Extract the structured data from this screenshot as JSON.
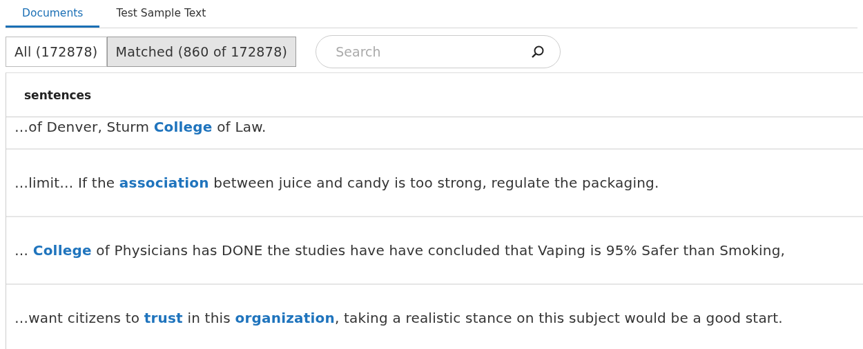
{
  "tabs": [
    {
      "label": "Documents",
      "selected": true
    },
    {
      "label": "Test Sample Text",
      "selected": false
    }
  ],
  "filters": [
    {
      "label": "All (172878)",
      "selected": false
    },
    {
      "label": "Matched (860 of 172878)",
      "selected": true
    }
  ],
  "search": {
    "placeholder": "Search"
  },
  "table": {
    "columns": [
      "sentences"
    ],
    "rows": [
      {
        "text": "…of Denver, Sturm **College** of Law."
      },
      {
        "text": "…limit… If the **association** between juice and candy is too strong, regulate the packaging."
      },
      {
        "text": "… **College** of Physicians has DONE the studies have have concluded that Vaping is 95% Safer than Smoking,"
      },
      {
        "text": "…want citizens to **trust** in this **organization**, taking a realistic stance on this subject would be a good start."
      }
    ]
  }
}
